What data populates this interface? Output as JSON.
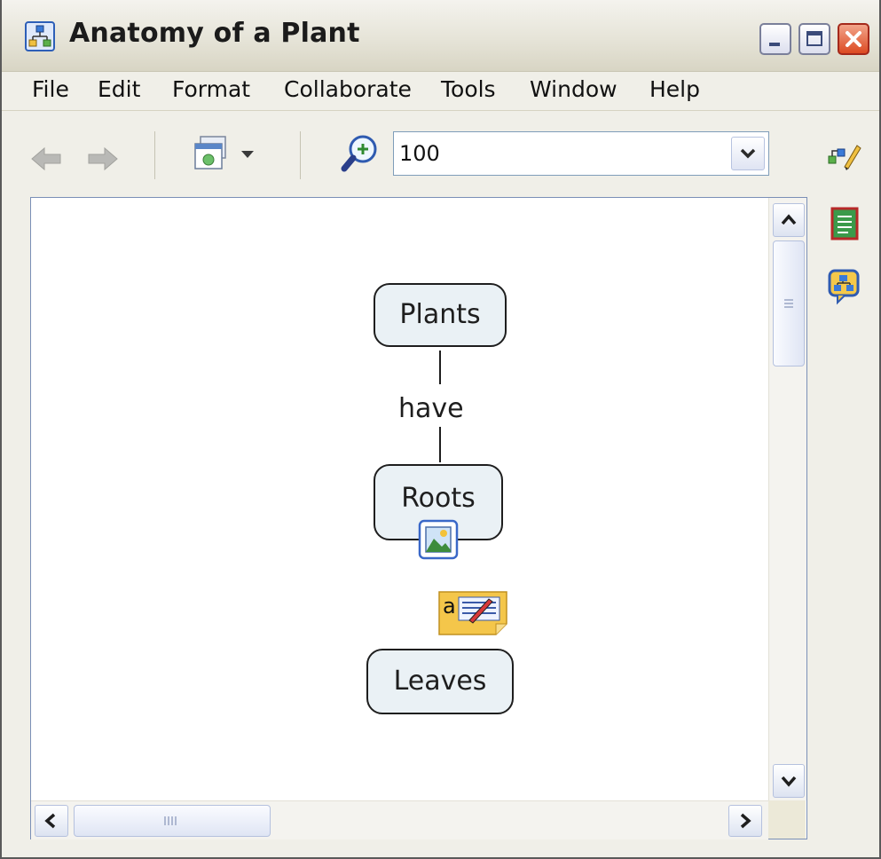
{
  "window": {
    "title": "Anatomy of a Plant"
  },
  "menubar": {
    "items": [
      "File",
      "Edit",
      "Format",
      "Collaborate",
      "Tools",
      "Window",
      "Help"
    ]
  },
  "toolbar": {
    "zoom_value": "100"
  },
  "map": {
    "nodes": [
      {
        "label": "Plants"
      },
      {
        "label": "Roots"
      },
      {
        "label": "Leaves"
      }
    ],
    "link_label": "have",
    "note_icon_letter": "a"
  },
  "colors": {
    "node_fill": "#eaf1f5",
    "node_border": "#1e1e1e",
    "close_button": "#dc4a22",
    "canvas_bg": "#ffffff"
  },
  "icons": [
    "app-icon",
    "minimize-icon",
    "maximize-icon",
    "close-icon",
    "back-arrow-icon",
    "forward-arrow-icon",
    "view-selector-icon",
    "zoom-icon",
    "chevron-down-icon",
    "edit-styles-icon",
    "notes-icon",
    "map-view-icon",
    "image-resource-icon",
    "text-annotation-icon"
  ]
}
